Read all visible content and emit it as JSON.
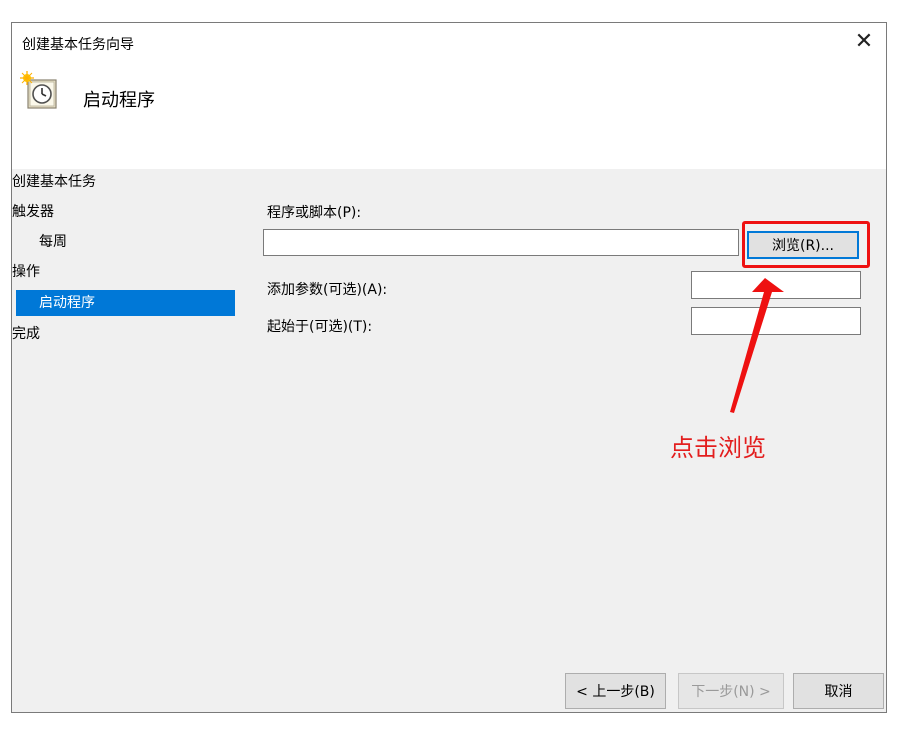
{
  "window": {
    "title": "创建基本任务向导",
    "close_symbol": "✕"
  },
  "header": {
    "title": "启动程序",
    "icon": "task-clock-icon"
  },
  "nav": {
    "items": [
      {
        "label": "创建基本任务"
      },
      {
        "label": "触发器"
      },
      {
        "label": "每周"
      },
      {
        "label": "操作"
      },
      {
        "label": "启动程序"
      },
      {
        "label": "完成"
      }
    ]
  },
  "form": {
    "program_label": "程序或脚本(P):",
    "program_value": "",
    "browse_label": "浏览(R)...",
    "args_label": "添加参数(可选)(A):",
    "args_value": "",
    "start_in_label": "起始于(可选)(T):",
    "start_in_value": ""
  },
  "footer": {
    "back_label": "< 上一步(B)",
    "next_label": "下一步(N) >",
    "cancel_label": "取消"
  },
  "annotation": {
    "text": "点击浏览",
    "color": "#e31e1e"
  },
  "colors": {
    "selection": "#0078d7",
    "window_bg": "#f0f0f0"
  }
}
